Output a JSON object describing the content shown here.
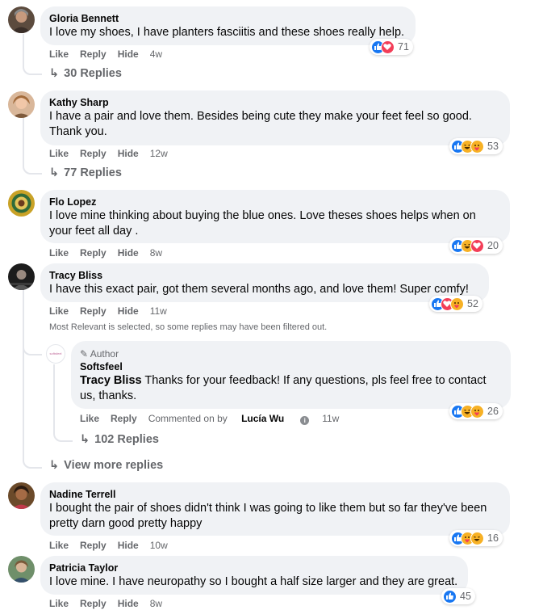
{
  "comments": [
    {
      "name": "Gloria Bennett",
      "text": "I love my shoes, I have planters fasciitis and these shoes really help.",
      "like": "Like",
      "reply": "Reply",
      "hide": "Hide",
      "time": "4w",
      "reactions": "71",
      "replies": "30 Replies"
    },
    {
      "name": "Kathy Sharp",
      "text": "I have a pair and love them. Besides being cute they make your feet feel so good. Thank you.",
      "like": "Like",
      "reply": "Reply",
      "hide": "Hide",
      "time": "12w",
      "reactions": "53",
      "replies": "77 Replies"
    },
    {
      "name": "Flo Lopez",
      "text": "I love mine thinking about buying the blue ones. Love theses shoes helps when on your feet all day .",
      "like": "Like",
      "reply": "Reply",
      "hide": "Hide",
      "time": "8w",
      "reactions": "20"
    },
    {
      "name": "Tracy Bliss",
      "text": "I have this exact pair, got them several months ago, and love them! Super comfy!",
      "like": "Like",
      "reply": "Reply",
      "hide": "Hide",
      "time": "11w",
      "reactions": "52",
      "filter_note": "Most Relevant is selected, so some replies may have been filtered out.",
      "view_more": "View more replies"
    },
    {
      "name": "Nadine Terrell",
      "text": "I bought the pair of shoes didn't think I was going to like them but so far they've been pretty darn good pretty happy",
      "like": "Like",
      "reply": "Reply",
      "hide": "Hide",
      "time": "10w",
      "reactions": "16"
    },
    {
      "name": "Patricia Taylor",
      "text": "I love mine. I have neuropathy so I bought a half size larger and they are great.",
      "like": "Like",
      "reply": "Reply",
      "hide": "Hide",
      "time": "8w",
      "reactions": "45"
    }
  ],
  "author_reply": {
    "badge": "Author",
    "name": "Softsfeel",
    "avatar_text": "softsfeel",
    "mention": "Tracy Bliss",
    "text": " Thanks for your feedback! If any questions, pls feel free to contact us, thanks.",
    "like": "Like",
    "reply": "Reply",
    "commented_by_prefix": "Commented on by ",
    "commented_by_name": "Lucía Wu",
    "time": "11w",
    "reactions": "26",
    "replies": "102 Replies"
  },
  "colors": {
    "like": "#1877f2",
    "love": "#f33e58",
    "haha": "#f7b125",
    "bubble": "#f0f2f5",
    "meta": "#65676b"
  }
}
